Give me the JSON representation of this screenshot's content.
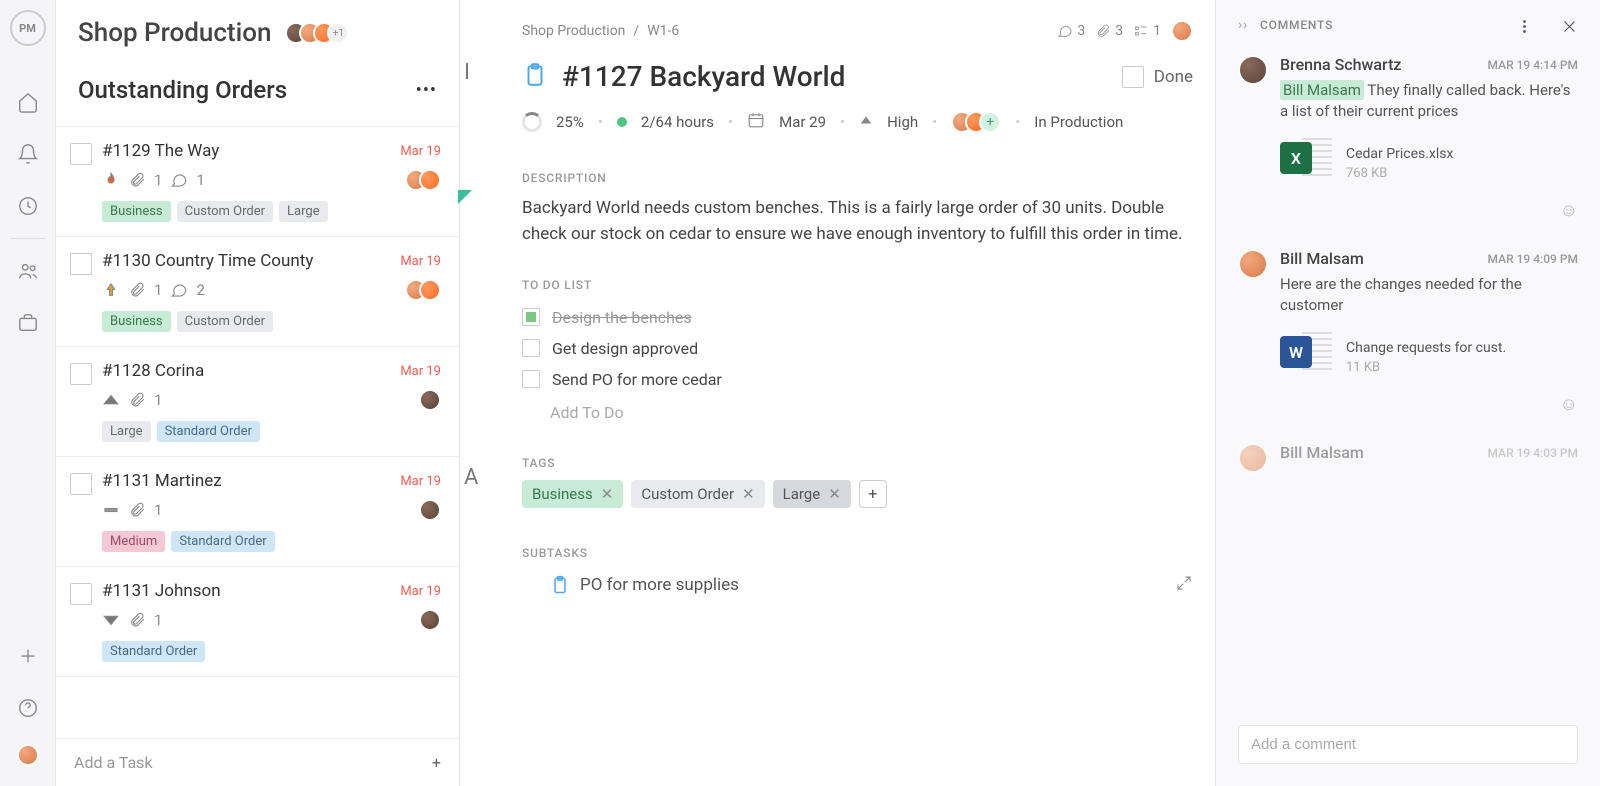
{
  "header": {
    "project_title": "Shop Production",
    "avatar_extra": "+1"
  },
  "column": {
    "title": "Outstanding Orders",
    "peek_title": "I",
    "peek_add": "A"
  },
  "tasks": [
    {
      "title": "#1129 The Way",
      "date": "Mar 19",
      "attachments": "1",
      "comments": "1",
      "priority": "critical",
      "tags": [
        {
          "label": "Business",
          "cls": "business"
        },
        {
          "label": "Custom Order",
          "cls": "custom"
        },
        {
          "label": "Large",
          "cls": "large"
        }
      ]
    },
    {
      "title": "#1130 Country Time County",
      "date": "Mar 19",
      "attachments": "1",
      "comments": "2",
      "priority": "high-orange",
      "tags": [
        {
          "label": "Business",
          "cls": "business"
        },
        {
          "label": "Custom Order",
          "cls": "custom"
        }
      ]
    },
    {
      "title": "#1128 Corina",
      "date": "Mar 19",
      "attachments": "1",
      "comments": "",
      "priority": "high",
      "tags": [
        {
          "label": "Large",
          "cls": "large"
        },
        {
          "label": "Standard Order",
          "cls": "standard-blue"
        }
      ]
    },
    {
      "title": "#1131 Martinez",
      "date": "Mar 19",
      "attachments": "1",
      "comments": "",
      "priority": "medium",
      "tags": [
        {
          "label": "Medium",
          "cls": "medium"
        },
        {
          "label": "Standard Order",
          "cls": "standard-blue"
        }
      ]
    },
    {
      "title": "#1131 Johnson",
      "date": "Mar 19",
      "attachments": "1",
      "comments": "",
      "priority": "low",
      "tags": [
        {
          "label": "Standard Order",
          "cls": "standard-blue"
        }
      ]
    }
  ],
  "add_task": "Add a Task",
  "detail": {
    "breadcrumb": {
      "project": "Shop Production",
      "group": "W1-6",
      "sep": "/"
    },
    "stats": {
      "comments": "3",
      "attachments": "3",
      "subtasks": "1"
    },
    "title": "#1127 Backyard World",
    "done_label": "Done",
    "progress": "25%",
    "hours": "2/64 hours",
    "due": "Mar 29",
    "priority": "High",
    "status": "In Production",
    "sections": {
      "description": "DESCRIPTION",
      "todo": "TO DO LIST",
      "tags": "TAGS",
      "subtasks": "SUBTASKS"
    },
    "description_text": "Backyard World needs custom benches. This is a fairly large order of 30 units. Double check our stock on cedar to ensure we have enough inventory to fulfill this order in time.",
    "todos": [
      {
        "label": "Design the benches",
        "done": true
      },
      {
        "label": "Get design approved",
        "done": false
      },
      {
        "label": "Send PO for more cedar",
        "done": false
      }
    ],
    "add_todo": "Add To Do",
    "tags": [
      {
        "label": "Business",
        "cls": "business"
      },
      {
        "label": "Custom Order",
        "cls": "custom"
      },
      {
        "label": "Large",
        "cls": "large"
      }
    ],
    "subtask": "PO for more supplies"
  },
  "comments": {
    "title": "COMMENTS",
    "items": [
      {
        "name": "Brenna Schwartz",
        "time": "MAR 19 4:14 PM",
        "mention": "Bill Malsam",
        "text": "They finally called back. Here's a list of their current prices",
        "file": {
          "name": "Cedar Prices.xlsx",
          "size": "768 KB",
          "app": "excel",
          "letter": "X"
        }
      },
      {
        "name": "Bill Malsam",
        "time": "MAR 19 4:09 PM",
        "mention": "",
        "text": "Here are the changes needed for the customer",
        "file": {
          "name": "Change requests for cust.",
          "size": "11 KB",
          "app": "word",
          "letter": "W"
        }
      },
      {
        "name": "Bill Malsam",
        "time": "MAR 19 4:03 PM",
        "mention": "",
        "text": "",
        "file": null
      }
    ],
    "add_placeholder": "Add a comment"
  }
}
